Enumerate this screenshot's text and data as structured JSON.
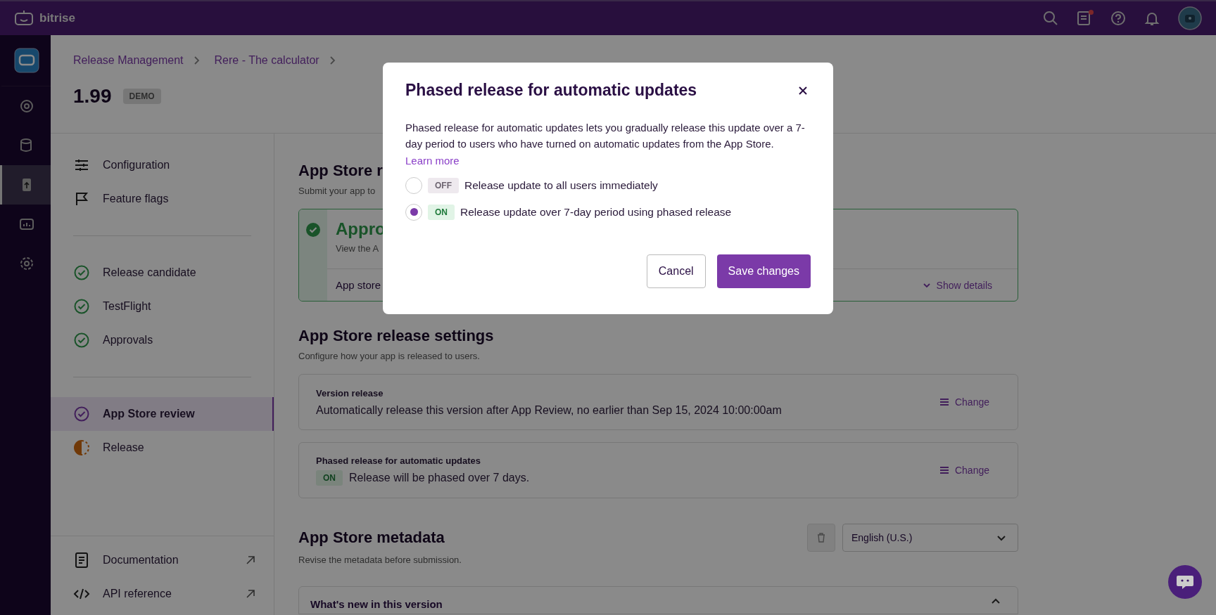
{
  "top_bar": {
    "logo": "bitrise",
    "unread": true
  },
  "rail": {
    "items": [
      {
        "selected": false
      },
      {
        "selected": false
      },
      {
        "selected": false
      },
      {
        "selected": true
      },
      {
        "selected": false
      },
      {
        "selected": false
      }
    ]
  },
  "breadcrumb": [
    "Release Management",
    "Rere - The calculator"
  ],
  "page": {
    "title": "1.99",
    "badge": "DEMO"
  },
  "sidebar": {
    "groups": [
      [
        {
          "kind": "tool",
          "label": "Configuration",
          "selected": false
        },
        {
          "kind": "tool",
          "label": "Feature flags",
          "selected": false
        }
      ],
      [
        {
          "kind": "done",
          "label": "Release candidate",
          "selected": false
        },
        {
          "kind": "done",
          "label": "TestFlight",
          "selected": false
        },
        {
          "kind": "done",
          "label": "Approvals",
          "selected": false
        }
      ],
      [
        {
          "kind": "current",
          "label": "App Store review",
          "selected": true
        },
        {
          "kind": "partial",
          "label": "Release",
          "selected": false
        }
      ]
    ],
    "footer": [
      {
        "kind": "docs",
        "label": "Documentation"
      },
      {
        "kind": "api",
        "label": "API reference"
      }
    ]
  },
  "review": {
    "title": "App Store r",
    "subtitle": "Submit your app to",
    "status_card": {
      "title": "Appro",
      "text": "View the A",
      "row_label": "App store",
      "action": "Show details"
    }
  },
  "release_settings": {
    "title": "App Store release settings",
    "subtitle": "Configure how your app is released to users.",
    "cards": [
      {
        "kind": "text",
        "label": "Version release",
        "value": "Automatically release this version after App Review, no earlier than Sep 15, 2024 10:00:00am",
        "action": "Change"
      },
      {
        "kind": "toggle",
        "label": "Phased release for automatic updates",
        "on": true,
        "badge": "ON",
        "value": "Release will be phased over 7 days.",
        "action": "Change"
      }
    ]
  },
  "metadata": {
    "title": "App Store metadata",
    "subtitle": "Revise the metadata before submission.",
    "language": "English (U.S.)",
    "section": "What's new in this version",
    "expanded": true
  },
  "modal": {
    "title": "Phased release for automatic updates",
    "body": "Phased release for automatic updates lets you gradually release this update over a 7-day period to users who have turned on automatic updates from the App Store.",
    "link": "Learn more",
    "options": [
      {
        "badge": "OFF",
        "on": false,
        "label": "Release update to all users immediately",
        "selected": false
      },
      {
        "badge": "ON",
        "on": true,
        "label": "Release update over 7-day period using phased release",
        "selected": true
      }
    ],
    "cancel": "Cancel",
    "save": "Save changes"
  }
}
